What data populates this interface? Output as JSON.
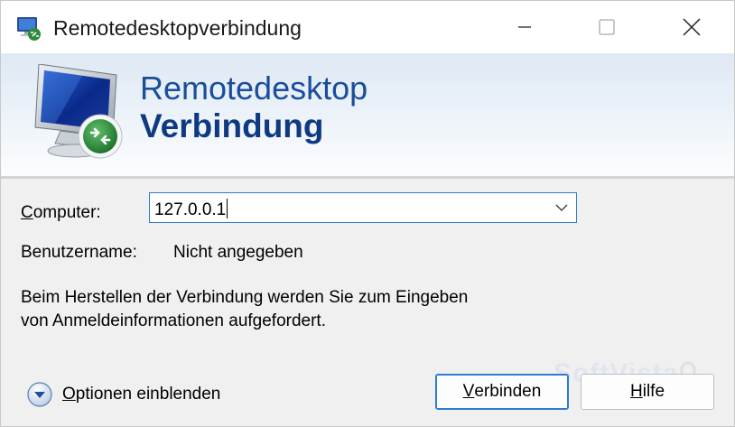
{
  "window": {
    "title": "Remotedesktopverbindung"
  },
  "banner": {
    "line1": "Remotedesktop",
    "line2": "Verbindung"
  },
  "form": {
    "computer_label_accel": "C",
    "computer_label_rest": "omputer:",
    "computer_value": "127.0.0.1",
    "username_label": "Benutzername:",
    "username_value": "Nicht angegeben",
    "info_line1": "Beim Herstellen der Verbindung werden Sie zum Eingeben",
    "info_line2": "von Anmeldeinformationen aufgefordert."
  },
  "footer": {
    "options_accel": "O",
    "options_rest": "ptionen einblenden",
    "connect_accel": "V",
    "connect_rest": "erbinden",
    "help_accel": "H",
    "help_rest": "ilfe"
  },
  "watermark": {
    "text": "SoftVista"
  },
  "colors": {
    "accent": "#2f7bd0",
    "banner_text": "#1a4d9b"
  },
  "icons": [
    "rdp-app-icon",
    "minimize-icon",
    "maximize-icon",
    "close-icon",
    "rdp-monitor-icon",
    "dropdown-arrow-icon",
    "expand-options-icon"
  ]
}
